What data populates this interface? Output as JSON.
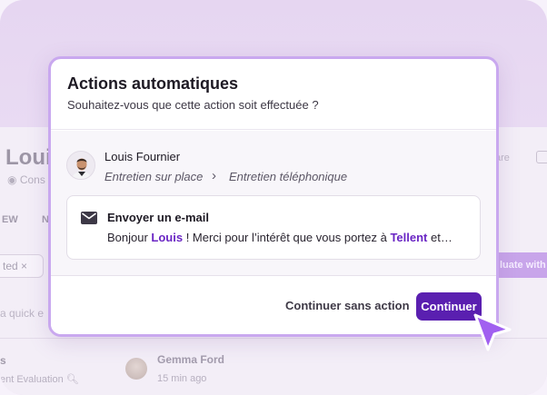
{
  "background": {
    "name_fragment": "Loui",
    "sub_fragment": "Cons",
    "tab_1": "EW",
    "tab_2": "N",
    "chip_text": "ted",
    "search_fragment": "a quick e",
    "row_title_fragment": "s",
    "row_sub_fragment": "ent Evaluation",
    "contact_name": "Gemma Ford",
    "contact_time": "15 min ago",
    "right_button_fragment": "luate with",
    "right_text_fragment": "are"
  },
  "modal": {
    "title": "Actions automatiques",
    "subtitle": "Souhaitez-vous que cette action soit effectuée ?",
    "person": {
      "name": "Louis Fournier",
      "stage_from": "Entretien sur place",
      "stage_arrow": "›",
      "stage_to": "Entretien téléphonique"
    },
    "email": {
      "icon": "envelope-icon",
      "title": "Envoyer un e-mail",
      "preview_start": "Bonjour ",
      "preview_name": "Louis",
      "preview_middle": " ! Merci pour l’intérêt que vous portez à ",
      "preview_company": "Tellent",
      "preview_end": " et…"
    },
    "buttons": {
      "secondary": "Continuer sans action",
      "primary": "Continuer"
    }
  },
  "colors": {
    "accent": "#5a1fb0",
    "highlight": "#6a26c4",
    "modal_border": "#c9a8ef",
    "cursor": "#a160f0"
  }
}
